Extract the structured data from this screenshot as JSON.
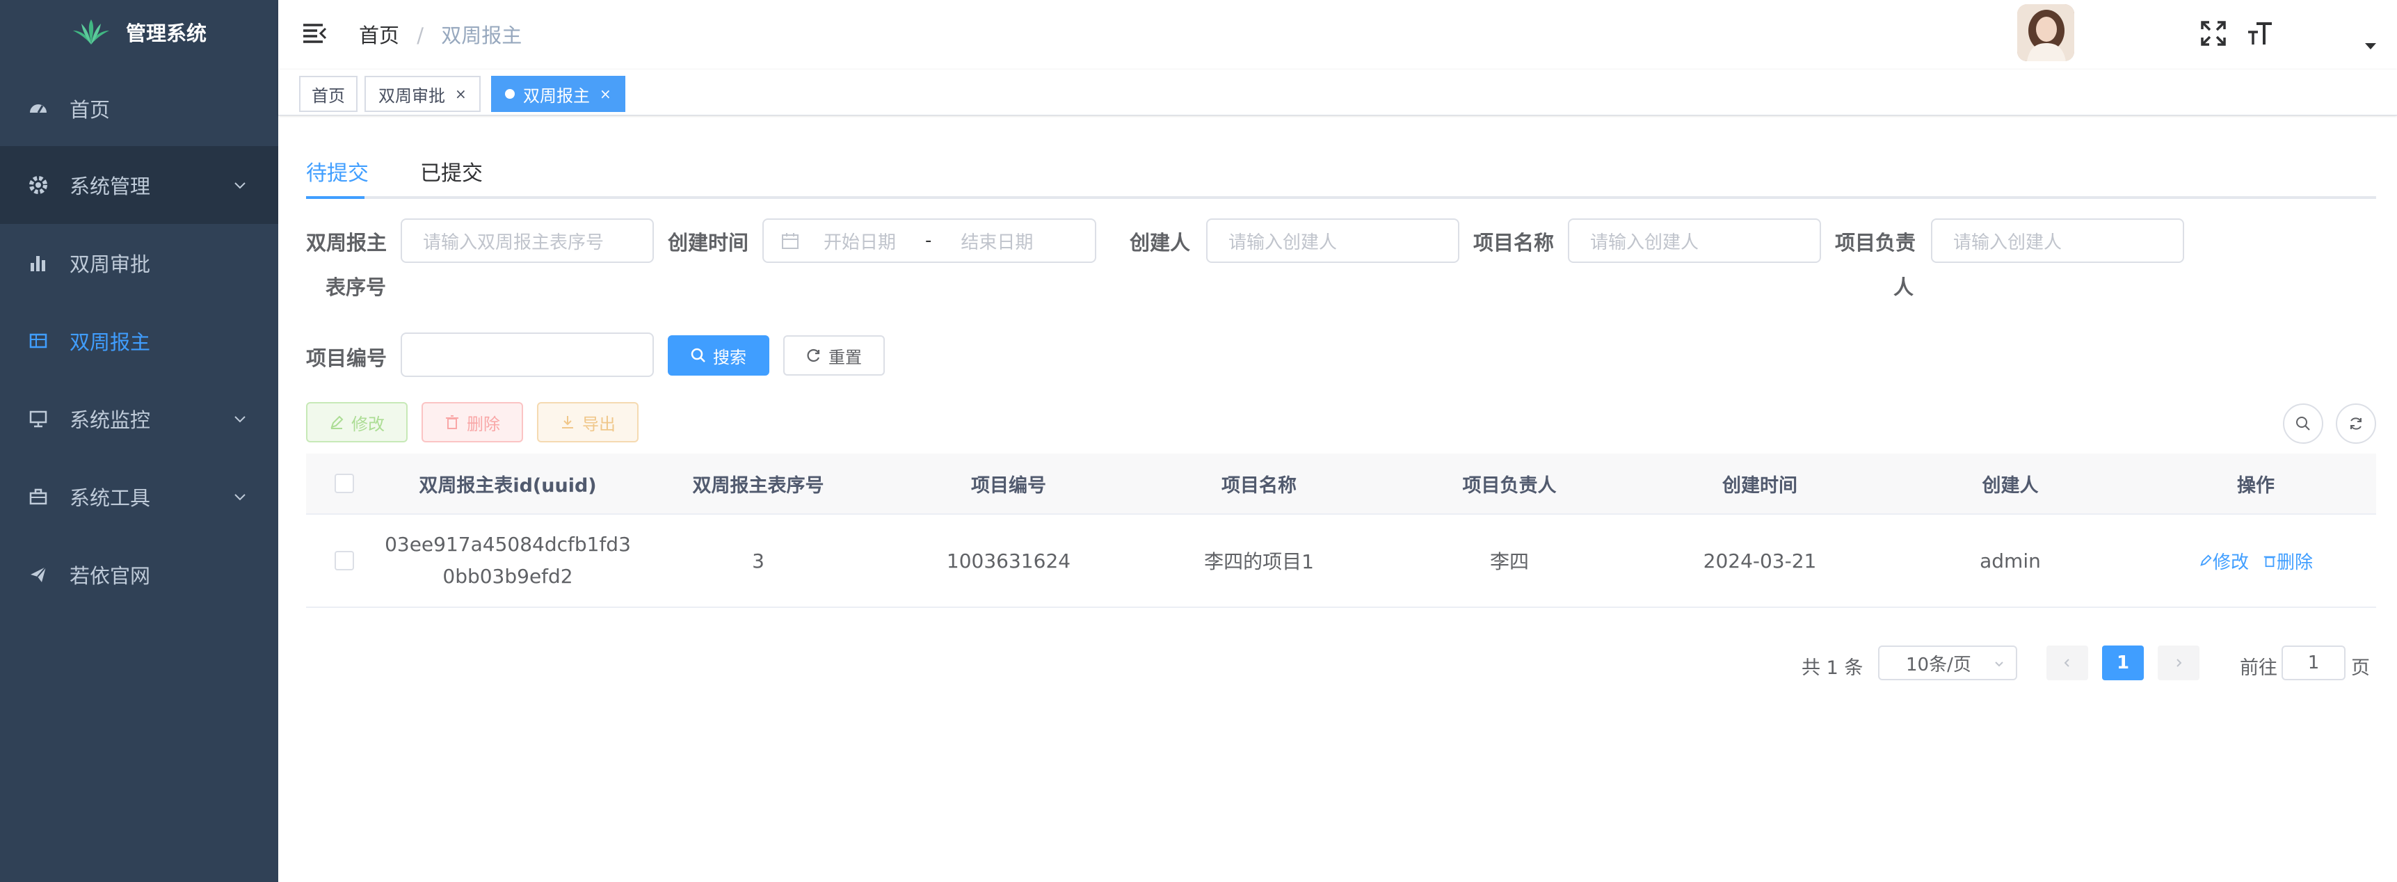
{
  "app": {
    "title": "管理系统"
  },
  "sidebar": {
    "items": [
      {
        "label": "首页",
        "icon": "dashboard-icon"
      },
      {
        "label": "系统管理",
        "icon": "gear-icon",
        "has_children": true
      },
      {
        "label": "双周审批",
        "icon": "bar-chart-icon"
      },
      {
        "label": "双周报主",
        "icon": "table-icon",
        "active": true
      },
      {
        "label": "系统监控",
        "icon": "monitor-icon",
        "has_children": true
      },
      {
        "label": "系统工具",
        "icon": "toolbox-icon",
        "has_children": true
      },
      {
        "label": "若依官网",
        "icon": "paper-plane-icon"
      }
    ]
  },
  "navbar": {
    "breadcrumb": {
      "home": "首页",
      "separator": "/",
      "current": "双周报主"
    }
  },
  "tags_view": {
    "tags": [
      {
        "label": "首页"
      },
      {
        "label": "双周审批",
        "close": "×"
      },
      {
        "label": "双周报主",
        "close": "×",
        "active": true
      }
    ]
  },
  "tabs": [
    {
      "label": "待提交",
      "active": true
    },
    {
      "label": "已提交"
    }
  ],
  "filters": {
    "serial_label": "双周报主",
    "serial_label_2": "表序号",
    "serial_placeholder": "请输入双周报主表序号",
    "created_time_label": "创建时间",
    "start_placeholder": "开始日期",
    "range_separator": "-",
    "end_placeholder": "结束日期",
    "creator_label": "创建人",
    "creator_placeholder": "请输入创建人",
    "project_name_label": "项目名称",
    "project_name_placeholder": "请输入创建人",
    "owner_label": "项目负责",
    "owner_label_2": "人",
    "owner_placeholder": "请输入创建人",
    "project_code_label": "项目编号",
    "project_code_value": "",
    "search_button": "搜索",
    "reset_button": "重置"
  },
  "toolbar": {
    "edit": "修改",
    "delete": "删除",
    "export": "导出"
  },
  "table": {
    "columns": [
      "双周报主表id(uuid)",
      "双周报主表序号",
      "项目编号",
      "项目名称",
      "项目负责人",
      "创建时间",
      "创建人",
      "操作"
    ],
    "rows": [
      {
        "uuid_line1": "03ee917a45084dcfb1fd3",
        "uuid_line2": "0bb03b9efd2",
        "serial": "3",
        "project_code": "1003631624",
        "project_name": "李四的项目1",
        "owner": "李四",
        "created": "2024-03-21",
        "creator": "admin",
        "edit": "修改",
        "delete": "删除"
      }
    ]
  },
  "pagination": {
    "total": "共 1 条",
    "page_size": "10条/页",
    "current_page": "1",
    "goto_label": "前往",
    "goto_value": "1",
    "page_suffix": "页"
  },
  "colors": {
    "sidebar_bg": "#304156",
    "accent": "#409eff",
    "active_tag": "#4a9ff9"
  }
}
